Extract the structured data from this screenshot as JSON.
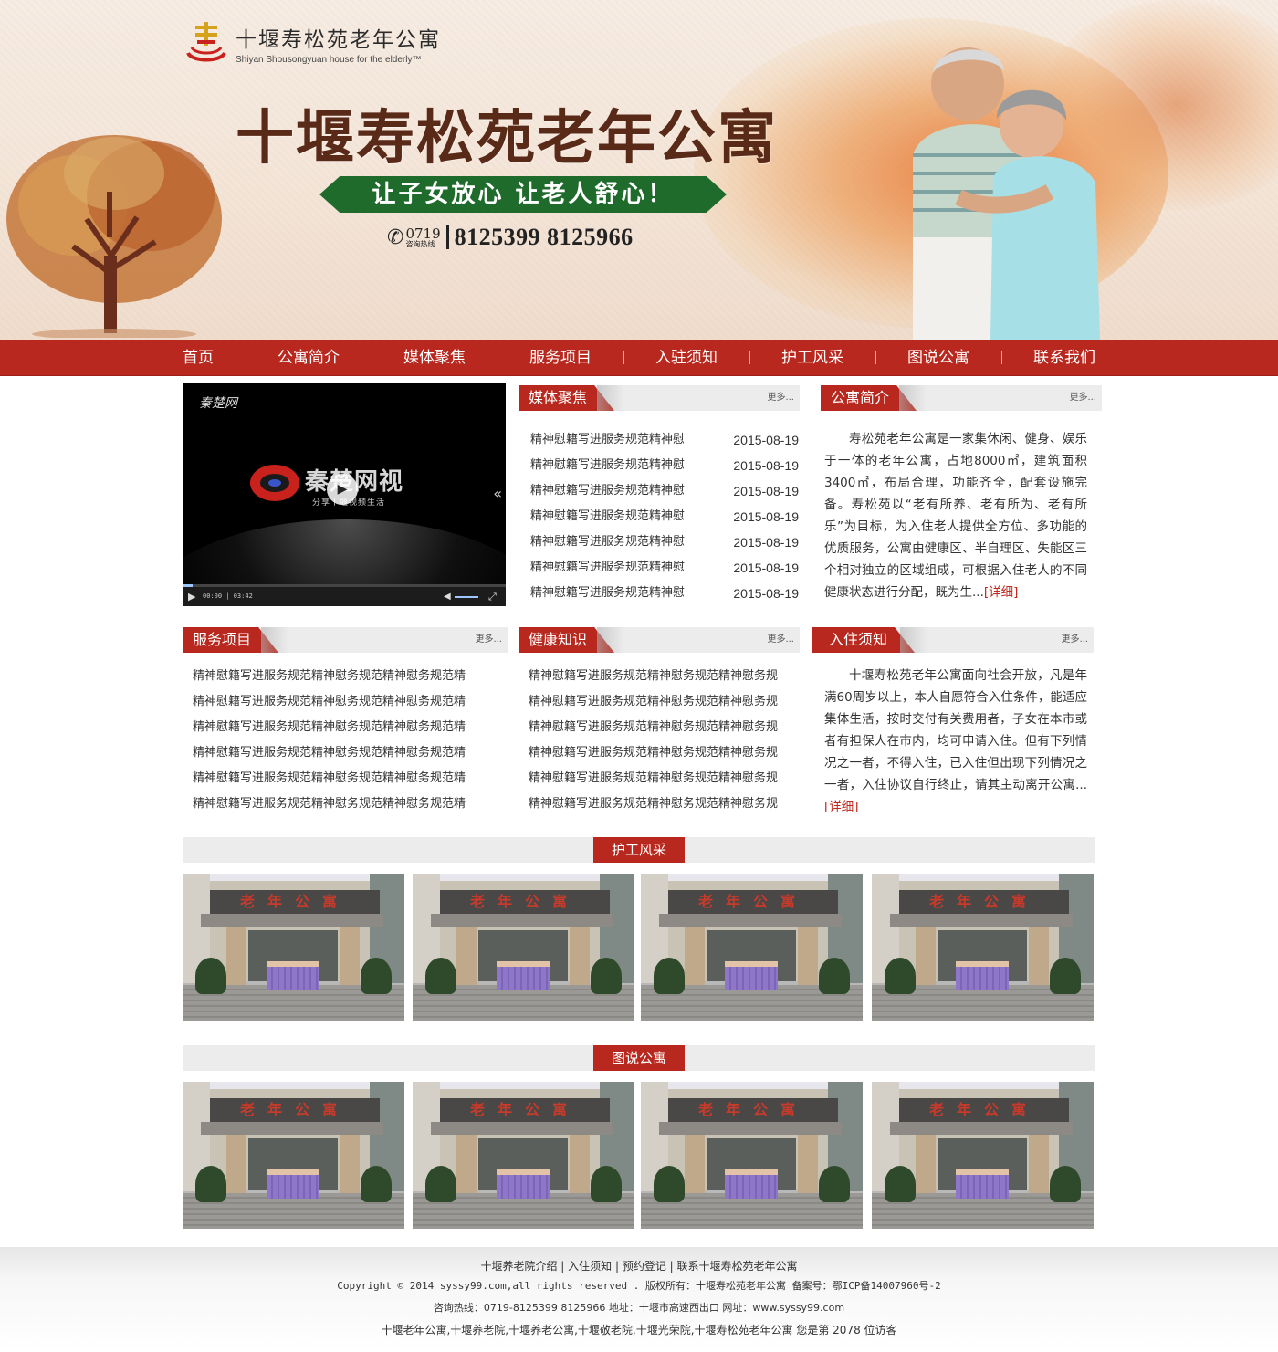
{
  "header": {
    "logo_cn": "十堰寿松苑老年公寓",
    "logo_en": "Shiyan Shousongyuan house for the elderly™",
    "hero_title": "十堰寿松苑老年公寓",
    "slogan": "让子女放心  让老人舒心！",
    "hotline_area_code": "0719",
    "hotline_label": "咨询热线",
    "hotline_numbers": "8125399  8125966"
  },
  "nav": {
    "items": [
      "首页",
      "公寓简介",
      "媒体聚焦",
      "服务项目",
      "入驻须知",
      "护工风采",
      "图说公寓",
      "联系我们"
    ]
  },
  "video": {
    "brand_top": "秦楚网",
    "brand": "秦楚网视",
    "subtitle": "分享丨堰视频生活",
    "time": "00:00 | 03:42"
  },
  "media": {
    "title": "媒体聚焦",
    "more": "更多...",
    "items": [
      {
        "text": "精神慰籍写进服务规范精神慰",
        "date": "2015-08-19"
      },
      {
        "text": "精神慰籍写进服务规范精神慰",
        "date": "2015-08-19"
      },
      {
        "text": "精神慰籍写进服务规范精神慰",
        "date": "2015-08-19"
      },
      {
        "text": "精神慰籍写进服务规范精神慰",
        "date": "2015-08-19"
      },
      {
        "text": "精神慰籍写进服务规范精神慰",
        "date": "2015-08-19"
      },
      {
        "text": "精神慰籍写进服务规范精神慰",
        "date": "2015-08-19"
      },
      {
        "text": "精神慰籍写进服务规范精神慰",
        "date": "2015-08-19"
      }
    ]
  },
  "intro": {
    "title": "公寓简介",
    "more": "更多...",
    "text": "寿松苑老年公寓是一家集休闲、健身、娱乐于一体的老年公寓，占地8000㎡，建筑面积3400㎡，布局合理，功能齐全，配套设施完备。寿松苑以“老有所养、老有所为、老有所乐”为目标，为入住老人提供全方位、多功能的优质服务，公寓由健康区、半自理区、失能区三个相对独立的区域组成，可根据入住老人的不同健康状态进行分配，既为生...",
    "detail": "[详细]"
  },
  "services": {
    "title": "服务项目",
    "more": "更多...",
    "items": [
      "精神慰籍写进服务规范精神慰务规范精神慰务规范精",
      "精神慰籍写进服务规范精神慰务规范精神慰务规范精",
      "精神慰籍写进服务规范精神慰务规范精神慰务规范精",
      "精神慰籍写进服务规范精神慰务规范精神慰务规范精",
      "精神慰籍写进服务规范精神慰务规范精神慰务规范精",
      "精神慰籍写进服务规范精神慰务规范精神慰务规范精"
    ]
  },
  "health": {
    "title": "健康知识",
    "more": "更多...",
    "items": [
      "精神慰籍写进服务规范精神慰务规范精神慰务规",
      "精神慰籍写进服务规范精神慰务规范精神慰务规",
      "精神慰籍写进服务规范精神慰务规范精神慰务规",
      "精神慰籍写进服务规范精神慰务规范精神慰务规",
      "精神慰籍写进服务规范精神慰务规范精神慰务规",
      "精神慰籍写进服务规范精神慰务规范精神慰务规"
    ]
  },
  "notice": {
    "title": "入住须知",
    "more": "更多...",
    "text": "十堰寿松苑老年公寓面向社会开放，凡是年满60周岁以上，本人自愿符合入住条件，能适应集体生活，按时交付有关费用者，子女在本市或者有担保人在市内，均可申请入住。但有下列情况之一者，不得入住，已入住但出现下列情况之一者，入住协议自行终止，请其主动离开公寓...",
    "detail": "[详细]"
  },
  "gallery1": {
    "title": "护工风采",
    "sign_text": "老年公寓"
  },
  "gallery2": {
    "title": "图说公寓",
    "sign_text": "老年公寓"
  },
  "footer": {
    "links_line": "十堰养老院介绍  |  入住须知  |  预约登记  |  联系十堰寿松苑老年公寓",
    "copyright": "Copyright © 2014 syssy99.com,all rights reserved . 版权所有：十堰寿松苑老年公寓  备案号：鄂ICP备14007960号-2",
    "contact": "咨询热线：0719-8125399   8125966   地址：十堰市高速西出口   网址：www.syssy99.com",
    "keywords": "十堰老年公寓,十堰养老院,十堰养老公寓,十堰敬老院,十堰光荣院,十堰寿松苑老年公寓 您是第 2078 位访客"
  },
  "colors": {
    "brand_red": "#b8281e",
    "slogan_green": "#1e6b2c",
    "title_brown": "#5a2a18"
  }
}
